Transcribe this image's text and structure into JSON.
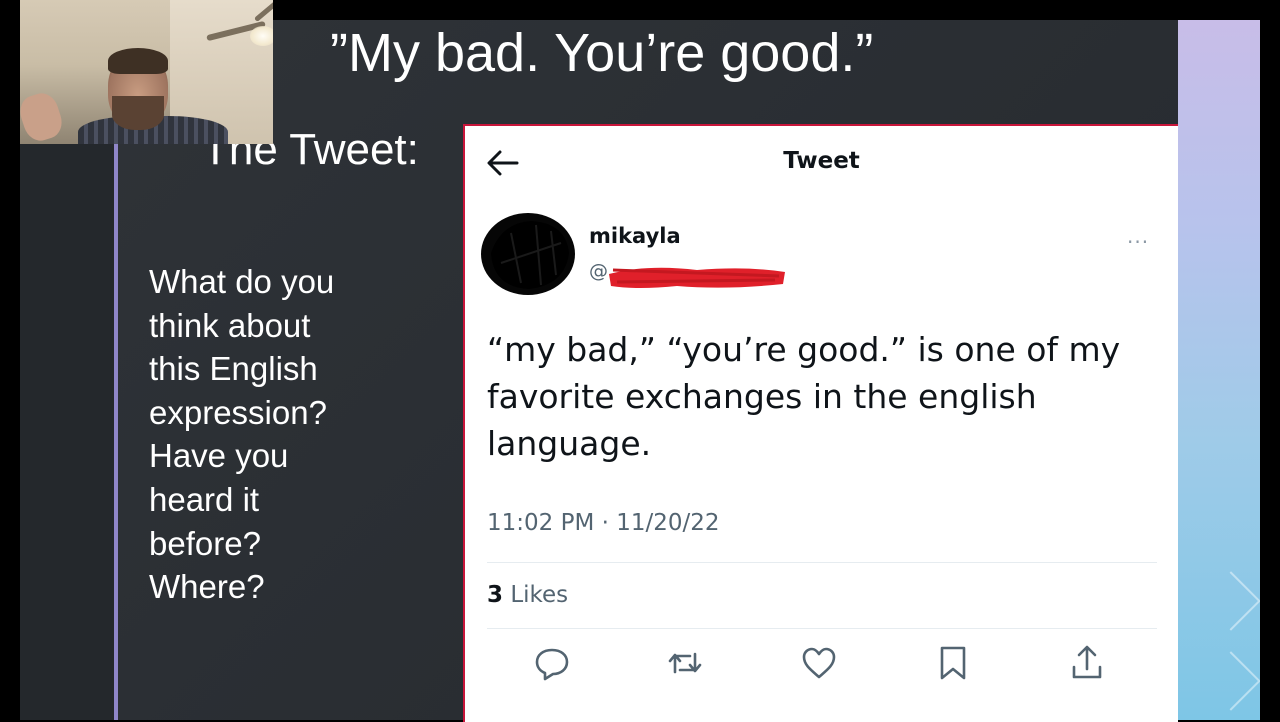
{
  "slide": {
    "title": "”My bad. You’re good.”",
    "subtitle": "The Tweet:",
    "question_lines": [
      "What do you",
      "think about",
      "this English",
      "expression?",
      "Have you",
      "heard it",
      "before?",
      "Where?"
    ]
  },
  "tweet": {
    "header": "Tweet",
    "author_name": "mikayla",
    "handle_prefix": "@",
    "more_icon": "···",
    "text": "“my bad,” “you’re good.” is one of my favorite exchanges in the english language.",
    "timestamp": "11:02 PM · 11/20/22",
    "likes_count": "3",
    "likes_label": "Likes",
    "icons": [
      "back-arrow-icon",
      "reply-icon",
      "retweet-icon",
      "like-icon",
      "bookmark-icon",
      "share-icon"
    ],
    "colors": {
      "card_border": "#c8153a",
      "redaction": "#e0202a",
      "text": "#0f1419",
      "muted": "#536471"
    }
  }
}
